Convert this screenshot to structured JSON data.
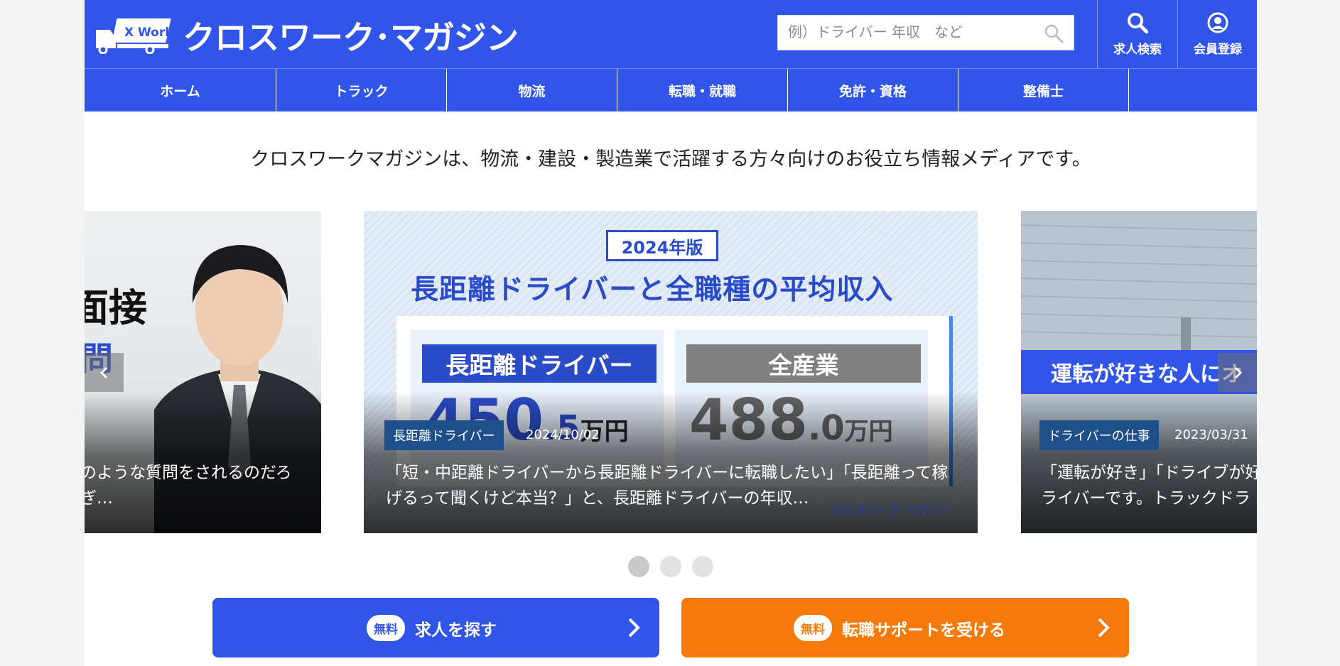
{
  "brand": {
    "logo_badge": "X Work",
    "name": "クロスワーク･マガジン"
  },
  "search": {
    "placeholder": "例）ドライバー 年収　など"
  },
  "header_actions": [
    {
      "label": "求人検索",
      "icon": "search-icon"
    },
    {
      "label": "会員登録",
      "icon": "user-circle-icon"
    }
  ],
  "nav": {
    "items": [
      {
        "label": "ホーム"
      },
      {
        "label": "トラック"
      },
      {
        "label": "物流"
      },
      {
        "label": "転職・就職"
      },
      {
        "label": "免許・資格"
      },
      {
        "label": "整備士"
      }
    ]
  },
  "tagline": "クロスワークマガジンは、物流・建設・製造業で活躍する方々向けのお役立ち情報メディアです。",
  "carousel": {
    "prev_icon": "chevron-left-icon",
    "next_icon": "chevron-right-icon",
    "slides": [
      {
        "image_text_1": "面接",
        "image_text_2": "問",
        "excerpt_line1": "のような質問をされるのだろ",
        "excerpt_line2": "ぎ…"
      },
      {
        "year_badge": "2024年版",
        "image_title": "長距離ドライバーと全職種の平均収入",
        "box1_label": "長距離ドライバー",
        "box1_value": "450",
        "box1_decimal": ".5",
        "box1_unit": "万円",
        "box2_label": "全産業",
        "box2_value": "488",
        "box2_decimal": ".0",
        "box2_unit": "万円",
        "watermark": "クロスワーク･マガジン",
        "category": "長距離ドライバー",
        "date": "2024/10/02",
        "excerpt_line1": "「短・中距離ドライバーから長距離ドライバーに転職したい」「長距離って稼",
        "excerpt_line2": "げるって聞くけど本当？」と、長距離ドライバーの年収…"
      },
      {
        "image_band": "運転が好きな人にオ",
        "category": "ドライバーの仕事",
        "date": "2023/03/31",
        "excerpt_line1": "「運転が好き」「ドライブが好",
        "excerpt_line2": "ライバーです。トラックドラ"
      }
    ],
    "dots": [
      {
        "active": true
      },
      {
        "active": false
      },
      {
        "active": false
      }
    ]
  },
  "cta": [
    {
      "badge": "無料",
      "label": "求人を探す",
      "color": "#3155e8"
    },
    {
      "badge": "無料",
      "label": "転職サポートを受ける",
      "color": "#f57a0b"
    }
  ],
  "colors": {
    "primary": "#3155e8",
    "accent": "#f57a0b",
    "badge_dark": "#1f4f88"
  }
}
